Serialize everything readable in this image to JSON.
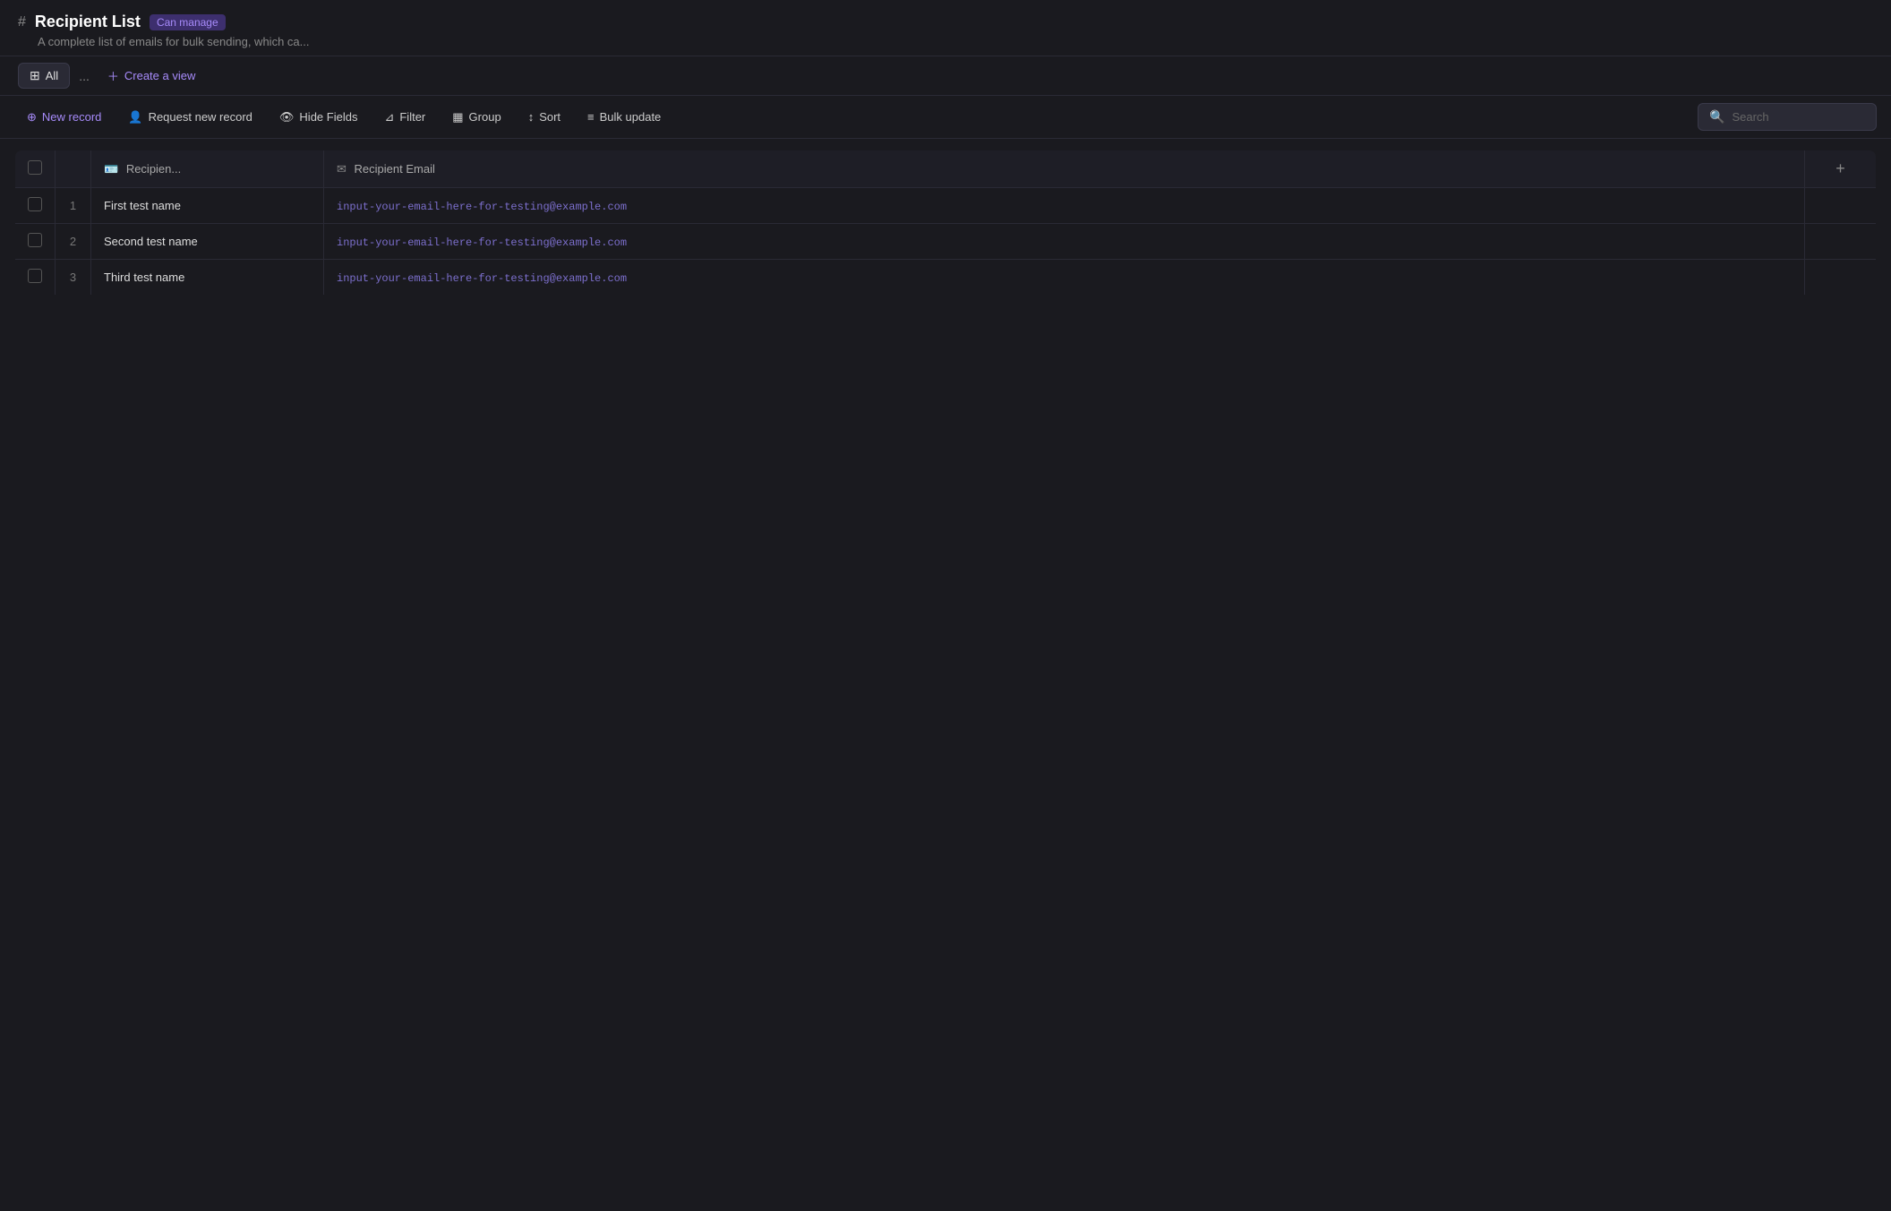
{
  "header": {
    "hash": "#",
    "title": "Recipient List",
    "badge": "Can manage",
    "subtitle": "A complete list of emails for bulk sending, which ca..."
  },
  "tabs": {
    "all_label": "All",
    "more_label": "...",
    "create_view_label": "Create a view"
  },
  "toolbar": {
    "new_record": "New record",
    "request_new_record": "Request new record",
    "hide_fields": "Hide Fields",
    "filter": "Filter",
    "group": "Group",
    "sort": "Sort",
    "bulk_update": "Bulk update",
    "search_placeholder": "Search"
  },
  "table": {
    "columns": [
      {
        "label": "Recipien...",
        "icon": "person-icon"
      },
      {
        "label": "Recipient Email",
        "icon": "mail-icon"
      }
    ],
    "rows": [
      {
        "id": 1,
        "name": "First test name",
        "email": "input-your-email-here-for-testing@example.com"
      },
      {
        "id": 2,
        "name": "Second test name",
        "email": "input-your-email-here-for-testing@example.com"
      },
      {
        "id": 3,
        "name": "Third test name",
        "email": "input-your-email-here-for-testing@example.com"
      }
    ]
  },
  "colors": {
    "accent": "#a78bfa",
    "badge_bg": "#3d2f6e",
    "badge_text": "#a78bfa",
    "email_color": "#7c6fcd"
  }
}
